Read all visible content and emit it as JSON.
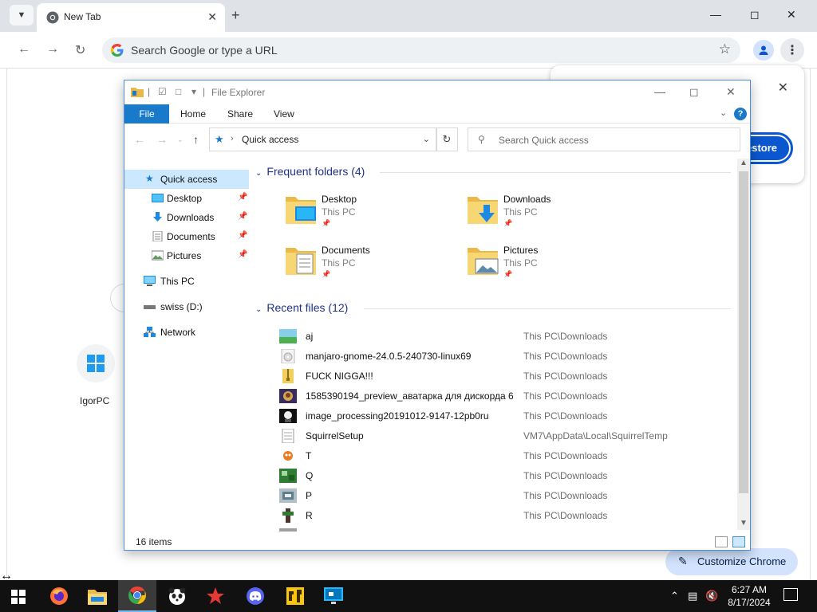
{
  "chrome": {
    "tab_title": "New Tab",
    "omnibox_placeholder": "Search Google or type a URL",
    "restore_label": "estore",
    "shortcut_label": "IgorPC",
    "customize_label": "Customize Chrome"
  },
  "explorer": {
    "title": "File Explorer",
    "ribbon_tabs": [
      "File",
      "Home",
      "Share",
      "View"
    ],
    "address": "Quick access",
    "search_placeholder": "Search Quick access",
    "nav": [
      {
        "label": "Quick access",
        "icon": "star-icon",
        "selected": true,
        "pinned": false
      },
      {
        "label": "Desktop",
        "icon": "desktop-icon",
        "selected": false,
        "pinned": true
      },
      {
        "label": "Downloads",
        "icon": "downloads-icon",
        "selected": false,
        "pinned": true
      },
      {
        "label": "Documents",
        "icon": "documents-icon",
        "selected": false,
        "pinned": true
      },
      {
        "label": "Pictures",
        "icon": "pictures-icon",
        "selected": false,
        "pinned": true
      },
      {
        "label": "This PC",
        "icon": "computer-icon",
        "selected": false,
        "pinned": false
      },
      {
        "label": "swiss (D:)",
        "icon": "drive-icon",
        "selected": false,
        "pinned": false
      },
      {
        "label": "Network",
        "icon": "network-icon",
        "selected": false,
        "pinned": false
      }
    ],
    "frequent_header": "Frequent folders (4)",
    "frequent": [
      {
        "name": "Desktop",
        "location": "This PC"
      },
      {
        "name": "Downloads",
        "location": "This PC"
      },
      {
        "name": "Documents",
        "location": "This PC"
      },
      {
        "name": "Pictures",
        "location": "This PC"
      }
    ],
    "recent_header": "Recent files (12)",
    "recent": [
      {
        "name": "aj",
        "path": "This PC\\Downloads",
        "icon": "image-file-icon"
      },
      {
        "name": "manjaro-gnome-24.0.5-240730-linux69",
        "path": "This PC\\Downloads",
        "icon": "disc-image-icon"
      },
      {
        "name": "FUCK NIGGA!!!",
        "path": "This PC\\Downloads",
        "icon": "zip-file-icon"
      },
      {
        "name": "1585390194_preview_аватарка для дискорда 6 ...",
        "path": "This PC\\Downloads",
        "icon": "image-file-icon"
      },
      {
        "name": "image_processing20191012-9147-12pb0ru",
        "path": "This PC\\Downloads",
        "icon": "image-file-icon"
      },
      {
        "name": "SquirrelSetup",
        "path": "VM7\\AppData\\Local\\SquirrelTemp",
        "icon": "text-file-icon"
      },
      {
        "name": "T",
        "path": "This PC\\Downloads",
        "icon": "image-file-icon"
      },
      {
        "name": "Q",
        "path": "This PC\\Downloads",
        "icon": "image-file-icon"
      },
      {
        "name": "P",
        "path": "This PC\\Downloads",
        "icon": "image-file-icon"
      },
      {
        "name": "R",
        "path": "This PC\\Downloads",
        "icon": "image-file-icon"
      }
    ],
    "status_count": "16 items"
  },
  "taskbar": {
    "time": "6:27 AM",
    "date": "8/17/2024",
    "apps": [
      "firefox-icon",
      "file-explorer-icon",
      "chrome-icon",
      "panda-icon",
      "red-star-icon",
      "discord-icon",
      "yellow-app-icon",
      "remote-desktop-icon"
    ]
  },
  "colors": {
    "chrome_tabstrip": "#dfe3e7",
    "omnibox_bg": "#eef1f4",
    "explorer_accent": "#1979ca",
    "section_header": "#1e3287",
    "nav_selected": "#cce8ff",
    "taskbar_bg": "#111111",
    "customize_bg": "#d3e3fd"
  }
}
